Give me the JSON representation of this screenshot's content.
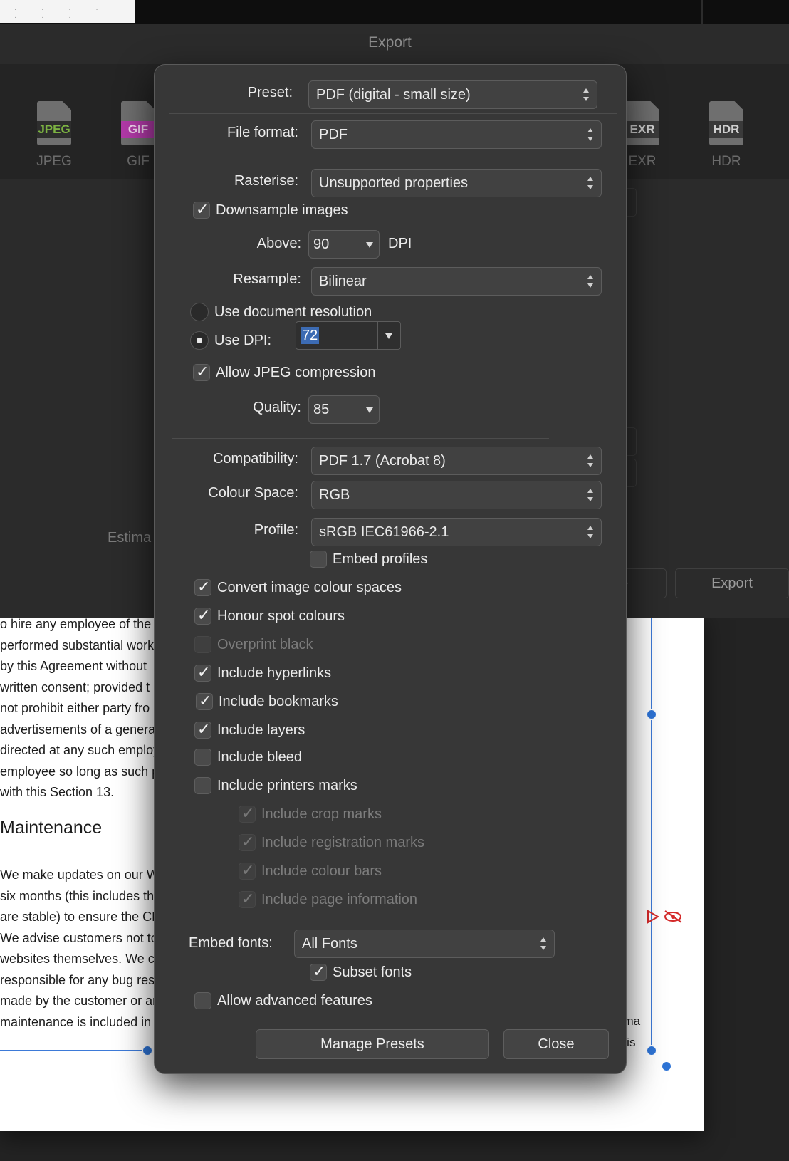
{
  "background": {
    "window_title": "Export",
    "formats": [
      {
        "tag": "JPEG",
        "label": "JPEG",
        "color": "#6ea33a"
      },
      {
        "tag": "GIF",
        "label": "GIF",
        "color": "#b23aa8"
      },
      {
        "tag": "EXR",
        "label": "EXR",
        "color": "#3a3a3a"
      },
      {
        "tag": "HDR",
        "label": "HDR",
        "color": "#3a3a3a"
      }
    ],
    "estimate_text": "Estima",
    "partial_button_label": "e",
    "export_button_label": "Export",
    "document_lines": [
      "o hire any employee of the",
      "performed substantial work",
      "by this Agreement without",
      "written consent; provided t",
      "not prohibit either party fro",
      "advertisements of a genera",
      "directed at any such employ",
      "employee so long as such p",
      "with this Section 13."
    ],
    "document_heading": "Maintenance",
    "document_lines_2": [
      "We make updates on our W",
      "six months (this includes th",
      "are stable) to ensure the CM",
      "We advise customers not to",
      "websites themselves. We ca",
      "responsible for any bug res",
      "made by the customer or ar",
      "maintenance is included in"
    ],
    "document_right_fragments": [
      "e.",
      "ema",
      "n is"
    ]
  },
  "dialog": {
    "preset": {
      "label": "Preset:",
      "value": "PDF (digital - small size)"
    },
    "file_format": {
      "label": "File format:",
      "value": "PDF"
    },
    "rasterise": {
      "label": "Rasterise:",
      "value": "Unsupported properties"
    },
    "downsample": {
      "label": "Downsample images",
      "checked": true
    },
    "above": {
      "label": "Above:",
      "value": "90",
      "unit": "DPI"
    },
    "resample": {
      "label": "Resample:",
      "value": "Bilinear"
    },
    "use_document_resolution": {
      "label": "Use document resolution",
      "selected": false
    },
    "use_dpi": {
      "label": "Use DPI:",
      "selected": true,
      "value": "72"
    },
    "allow_jpeg": {
      "label": "Allow JPEG compression",
      "checked": true
    },
    "quality": {
      "label": "Quality:",
      "value": "85"
    },
    "compatibility": {
      "label": "Compatibility:",
      "value": "PDF 1.7 (Acrobat 8)"
    },
    "colour_space": {
      "label": "Colour Space:",
      "value": "RGB"
    },
    "profile": {
      "label": "Profile:",
      "value": "sRGB IEC61966-2.1"
    },
    "embed_profiles": {
      "label": "Embed profiles",
      "checked": false
    },
    "options": [
      {
        "label": "Convert image colour spaces",
        "checked": true,
        "enabled": true
      },
      {
        "label": "Honour spot colours",
        "checked": true,
        "enabled": true
      },
      {
        "label": "Overprint black",
        "checked": false,
        "enabled": false
      },
      {
        "label": "Include hyperlinks",
        "checked": true,
        "enabled": true
      },
      {
        "label": "Include bookmarks",
        "checked": true,
        "enabled": true
      },
      {
        "label": "Include layers",
        "checked": true,
        "enabled": true
      },
      {
        "label": "Include bleed",
        "checked": false,
        "enabled": true
      },
      {
        "label": "Include printers marks",
        "checked": false,
        "enabled": true
      }
    ],
    "printer_marks": [
      {
        "label": "Include crop marks",
        "checked": true
      },
      {
        "label": "Include registration marks",
        "checked": true
      },
      {
        "label": "Include colour bars",
        "checked": true
      },
      {
        "label": "Include page information",
        "checked": true
      }
    ],
    "embed_fonts": {
      "label": "Embed  fonts:",
      "value": "All Fonts"
    },
    "subset_fonts": {
      "label": "Subset fonts",
      "checked": true
    },
    "allow_advanced": {
      "label": "Allow advanced features",
      "checked": false
    },
    "buttons": {
      "manage_presets": "Manage Presets",
      "close": "Close"
    }
  },
  "colors": {
    "accent": "#2e74d6",
    "selection": "#3c6bb3",
    "dialog_bg": "#373737"
  }
}
